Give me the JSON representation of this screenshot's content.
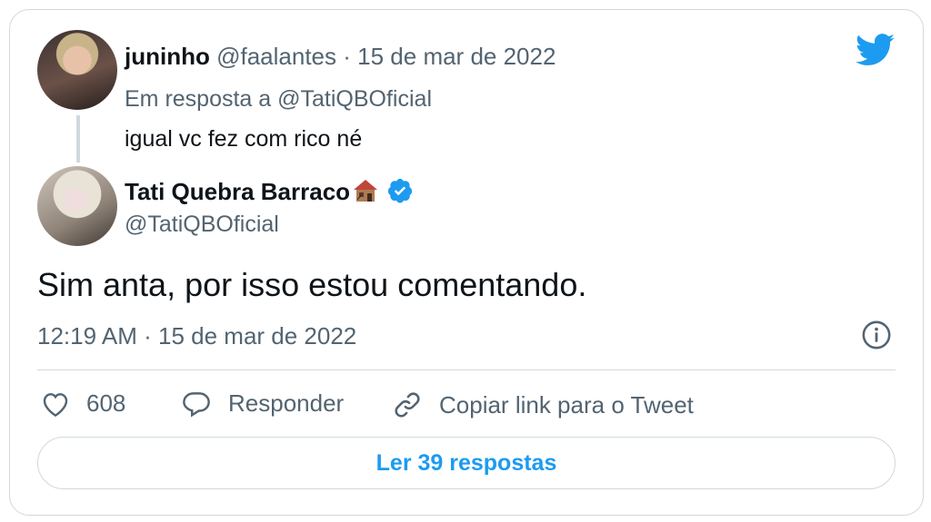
{
  "reply_tweet": {
    "display_name": "juninho",
    "handle": "@faalantes",
    "separator": "·",
    "date": "15 de mar de 2022",
    "in_reply_to_prefix": "Em resposta a",
    "in_reply_to_handle": "@TatiQBOficial",
    "text": "igual vc fez com rico né"
  },
  "main_tweet": {
    "display_name": "Tati Quebra Barraco",
    "handle": "@TatiQBOficial",
    "text": "Sim anta, por isso estou comentando.",
    "time": "12:19 AM",
    "separator": "·",
    "date": "15 de mar de 2022",
    "verified": true
  },
  "actions": {
    "like_count": "608",
    "reply_label": "Responder",
    "copy_label": "Copiar link para o Tweet"
  },
  "replies_button": "Ler 39 respostas",
  "icons": {
    "brand": "twitter-bird-icon",
    "info": "info-icon",
    "like": "heart-icon",
    "reply": "speech-bubble-icon",
    "copy": "link-icon",
    "verified": "verified-badge-icon"
  },
  "colors": {
    "brand_blue": "#1d9bf0",
    "muted": "#536471",
    "border": "#cfd9de",
    "text": "#0f1419"
  }
}
